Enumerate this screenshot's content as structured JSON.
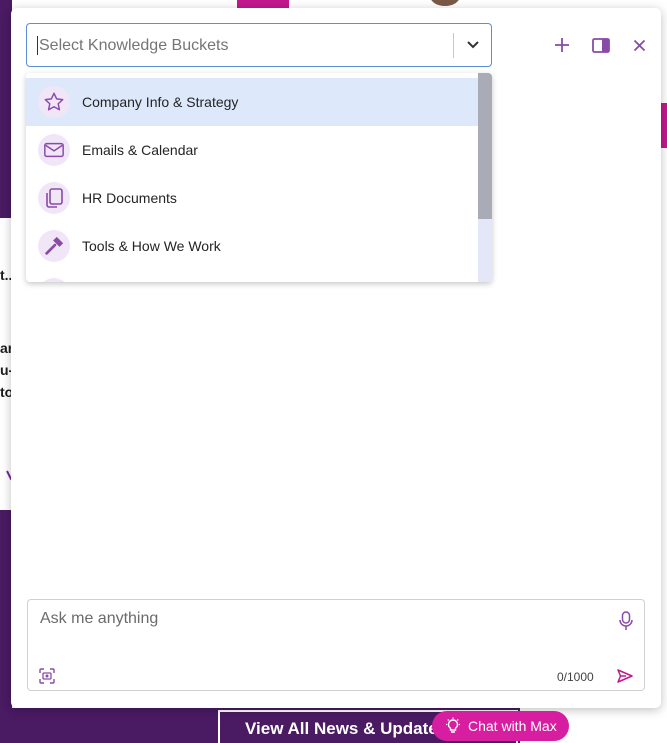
{
  "background": {
    "fragments": [
      "t..",
      "ar",
      "u-",
      "to"
    ],
    "news_button": "View All News & Updates"
  },
  "header": {
    "kb_select_placeholder": "Select Knowledge Buckets"
  },
  "kb_options": [
    {
      "label": "Company Info & Strategy",
      "icon": "star-icon"
    },
    {
      "label": "Emails & Calendar",
      "icon": "mail-icon"
    },
    {
      "label": "HR Documents",
      "icon": "copy-icon"
    },
    {
      "label": "Tools & How We Work",
      "icon": "hammer-icon"
    }
  ],
  "composer": {
    "placeholder": "Ask me anything",
    "counter": "0/1000"
  },
  "launcher": {
    "label": "Chat with Max"
  },
  "colors": {
    "accent": "#8a4aa8",
    "brand": "#d81ea0",
    "dark_purple": "#4a1a63",
    "focus_blue": "#5b8fd6"
  }
}
